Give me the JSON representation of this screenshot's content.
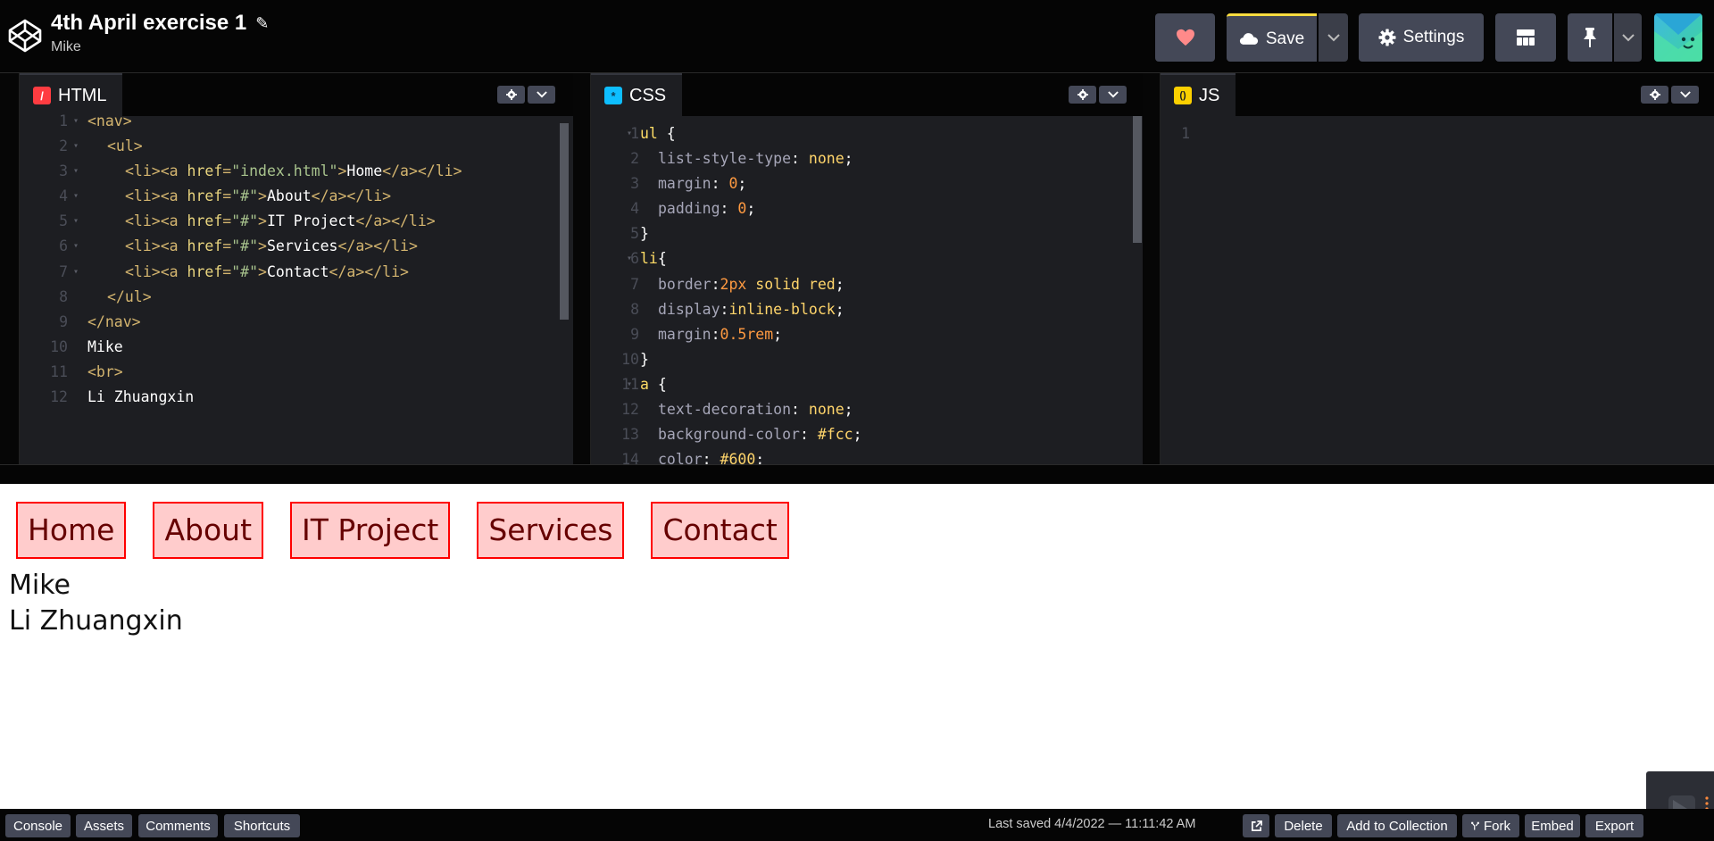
{
  "header": {
    "title": "4th April exercise 1",
    "author": "Mike",
    "save_label": "Save",
    "settings_label": "Settings",
    "colors": {
      "accent": "#ffdd40",
      "heart": "#ff8a8a",
      "button_bg": "#444857"
    }
  },
  "editors": {
    "html": {
      "label": "HTML",
      "icon_glyph": "/",
      "lines": [
        {
          "n": "1",
          "fold": true
        },
        {
          "n": "2",
          "fold": true
        },
        {
          "n": "3",
          "fold": true
        },
        {
          "n": "4",
          "fold": true
        },
        {
          "n": "5",
          "fold": true
        },
        {
          "n": "6",
          "fold": true
        },
        {
          "n": "7",
          "fold": true
        },
        {
          "n": "8",
          "fold": false
        },
        {
          "n": "9",
          "fold": false
        },
        {
          "n": "10",
          "fold": false
        },
        {
          "n": "11",
          "fold": false
        },
        {
          "n": "12",
          "fold": false
        }
      ],
      "code": {
        "l1_open": "<nav>",
        "l2_open": "<ul>",
        "li_open": "<li><a ",
        "attr": "href",
        "eq": "=",
        "href_index": "\"index.html\"",
        "href_hash": "\"#\"",
        "gt": ">",
        "home": "Home",
        "about": "About",
        "it": "IT Project",
        "services": "Services",
        "contact": "Contact",
        "close_li": "</a></li>",
        "l8_close": "</ul>",
        "l9_close": "</nav>",
        "l10": "Mike",
        "l11": "<br>",
        "l12": "Li Zhuangxin"
      }
    },
    "css": {
      "label": "CSS",
      "icon_glyph": "*",
      "line_numbers": [
        "1",
        "2",
        "3",
        "4",
        "5",
        "6",
        "7",
        "8",
        "9",
        "10",
        "11",
        "12",
        "13",
        "14"
      ],
      "code": {
        "sel_ul": "ul",
        "brace_open": " {",
        "brace_open_tight": "{",
        "brace_close": "}",
        "p_list": "list-style-type",
        "v_none": "none",
        "p_margin": "margin",
        "v_zero": "0",
        "p_padding": "padding",
        "sel_li": "li",
        "p_border": "border",
        "v_2px": "2px",
        "v_solid": " solid red",
        "p_display": "display",
        "v_inline": "inline-block",
        "v_05": "0.5rem",
        "sel_a": "a",
        "p_textdec": "text-decoration",
        "p_bg": "background-color",
        "v_fcc": "#fcc",
        "p_color": "color",
        "v_600": "#600",
        "colon_sp": ": ",
        "colon": ":",
        "semi": ";"
      }
    },
    "js": {
      "label": "JS",
      "icon_glyph": "()",
      "line_numbers": [
        "1"
      ]
    }
  },
  "preview": {
    "nav": [
      "Home",
      "About",
      "IT Project",
      "Services",
      "Contact"
    ],
    "lines": [
      "Mike",
      "Li Zhuangxin"
    ]
  },
  "footer": {
    "left": [
      "Console",
      "Assets",
      "Comments",
      "Shortcuts"
    ],
    "last_saved": "Last saved 4/4/2022 — 11:11:42 AM",
    "right": {
      "delete": "Delete",
      "collection": "Add to Collection",
      "fork": "Fork",
      "embed": "Embed",
      "export": "Export"
    }
  }
}
